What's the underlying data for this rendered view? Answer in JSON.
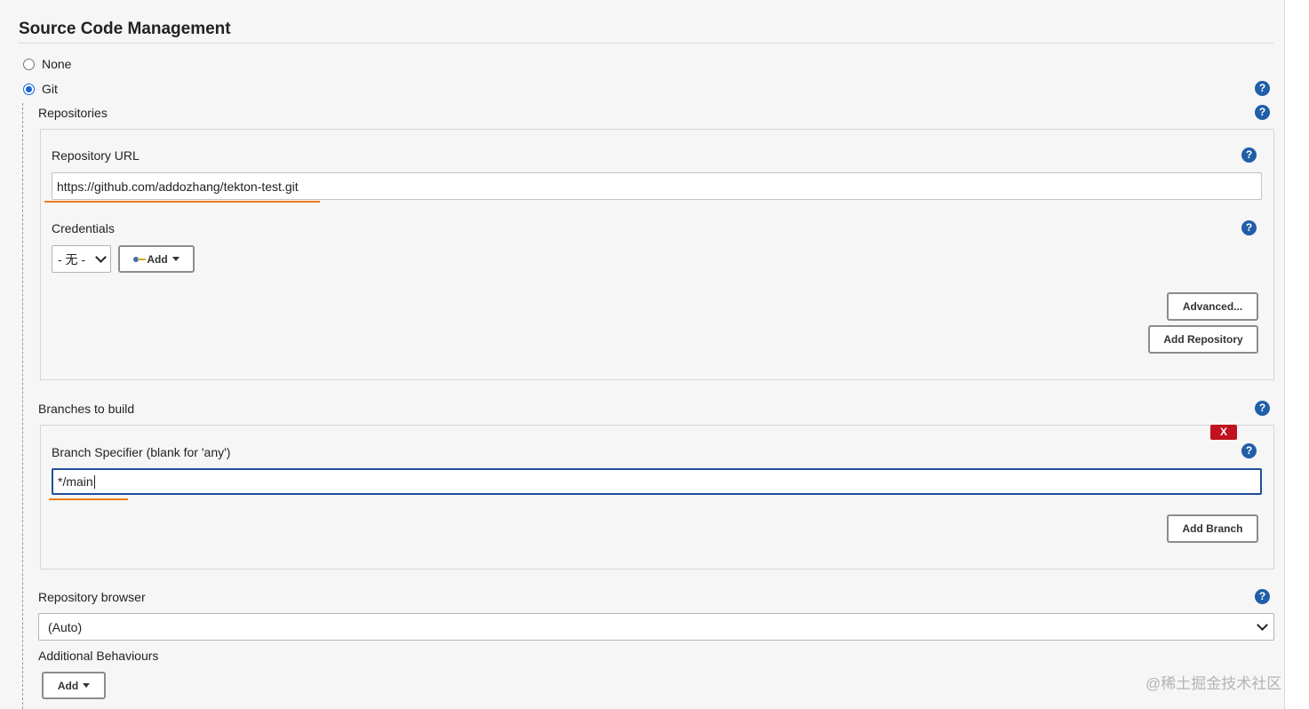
{
  "section": {
    "title": "Source Code Management"
  },
  "scm_options": [
    {
      "label": "None",
      "checked": false
    },
    {
      "label": "Git",
      "checked": true
    }
  ],
  "help_glyph": "?",
  "repositories": {
    "label": "Repositories",
    "repo_url_label": "Repository URL",
    "repo_url_value": "https://github.com/addozhang/tekton-test.git",
    "credentials_label": "Credentials",
    "credentials_selected": "- 无 -",
    "add_label": "Add",
    "advanced_label": "Advanced...",
    "add_repository_label": "Add Repository"
  },
  "branches": {
    "label": "Branches to build",
    "delete_label": "X",
    "specifier_label": "Branch Specifier (blank for 'any')",
    "specifier_value": "*/main",
    "add_branch_label": "Add Branch"
  },
  "repo_browser": {
    "label": "Repository browser",
    "selected": "(Auto)"
  },
  "additional": {
    "label": "Additional Behaviours",
    "add_label": "Add"
  },
  "watermark": "@稀土掘金技术社区",
  "icons": {
    "help": "help-icon",
    "key": "key-icon",
    "caret": "caret-down-icon",
    "chevron": "chevron-down-icon"
  },
  "colors": {
    "help_blue": "#205ea8",
    "annotation_orange": "#f07b1b",
    "delete_red": "#c1121f",
    "focus_blue": "#1f4f9c"
  }
}
